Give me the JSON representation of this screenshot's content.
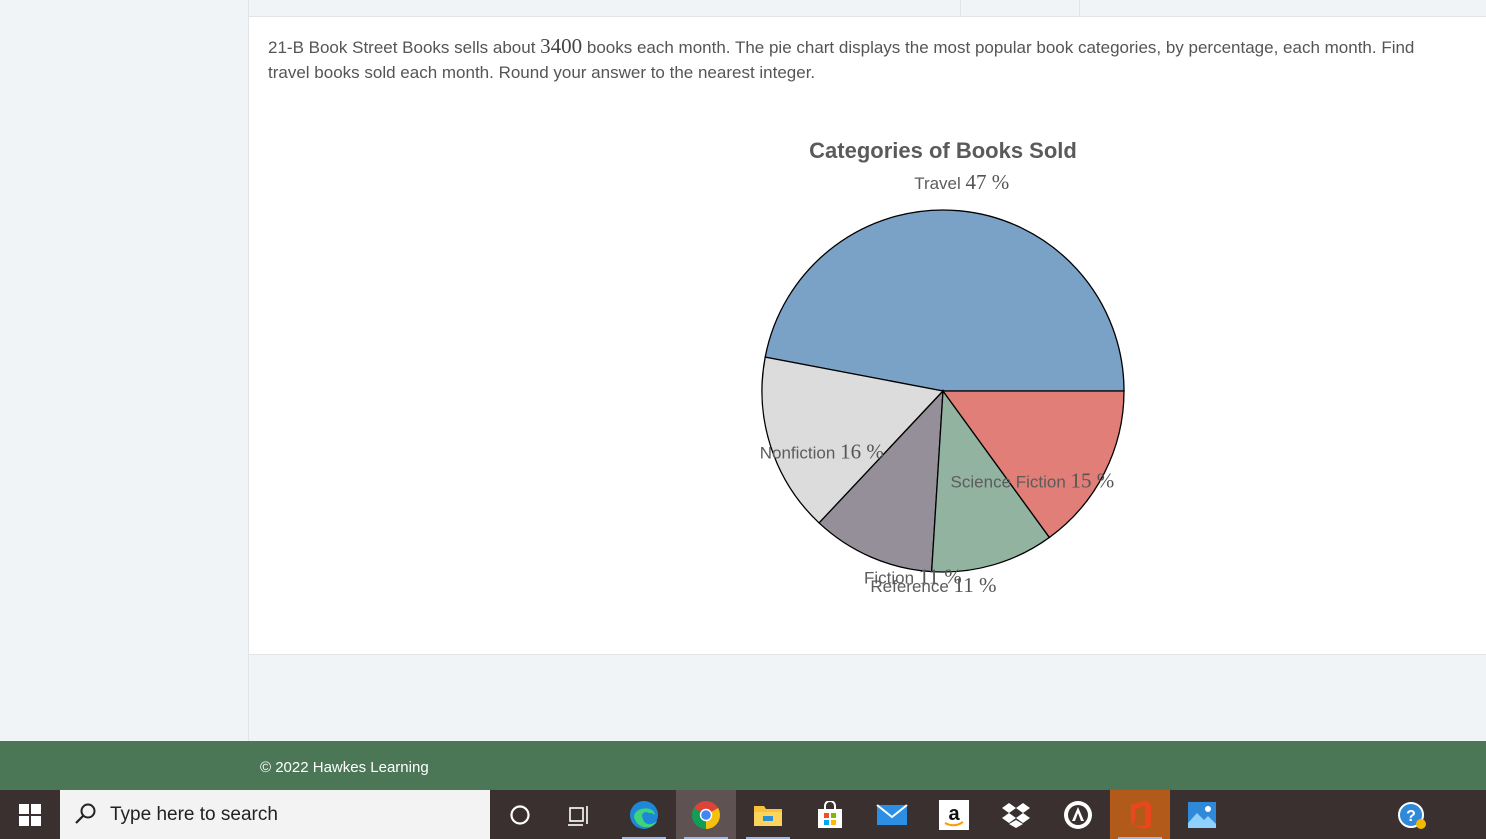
{
  "question": {
    "prefix": "21-B Book Street Books sells about ",
    "number": "3400",
    "suffix": " books each month. The pie chart displays the most popular book categories, by percentage, each month. Find",
    "line2": "travel books sold each month. Round your answer to the nearest integer."
  },
  "chart_data": {
    "type": "pie",
    "title": "Categories of Books Sold",
    "categories": [
      "Travel",
      "Nonfiction",
      "Fiction",
      "Reference",
      "Science Fiction"
    ],
    "values": [
      47,
      16,
      11,
      11,
      15
    ],
    "pct_labels": [
      "47 %",
      "16 %",
      "11 %",
      "11 %",
      "15 %"
    ],
    "colors": [
      "#7aa1c6",
      "#dcdcdc",
      "#958f99",
      "#93b3a1",
      "#e07e77"
    ]
  },
  "footer": {
    "copyright": "© 2022 Hawkes Learning"
  },
  "taskbar": {
    "search_placeholder": "Type here to search",
    "icons": [
      "windows-start-icon",
      "cortana-icon",
      "task-view-icon",
      "edge-icon",
      "chrome-icon",
      "file-explorer-icon",
      "store-icon",
      "mail-icon",
      "amazon-icon",
      "dropbox-icon",
      "app-icon",
      "office-icon",
      "photos-icon",
      "help-icon"
    ],
    "amazon_glyph": "a"
  }
}
